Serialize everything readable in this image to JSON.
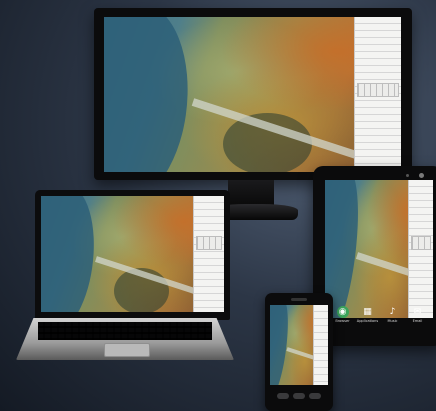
{
  "scene": {
    "devices": [
      "monitor",
      "laptop",
      "tablet",
      "phone"
    ],
    "screen_content": "aerial-map"
  },
  "tablet": {
    "apps": [
      {
        "icon": "globe-icon",
        "glyph": "◉",
        "label": "Browser",
        "color": "#3aa35a"
      },
      {
        "icon": "grid-icon",
        "glyph": "▦",
        "label": "Applications",
        "color": "#444444"
      },
      {
        "icon": "music-icon",
        "glyph": "♪",
        "label": "Music",
        "color": "#444444"
      },
      {
        "icon": "mail-icon",
        "glyph": "✉",
        "label": "Email",
        "color": "#444444"
      }
    ]
  },
  "colors": {
    "background": "#2c3646",
    "device_body": "#0b0b0c",
    "panel": "#f4f4f2"
  }
}
